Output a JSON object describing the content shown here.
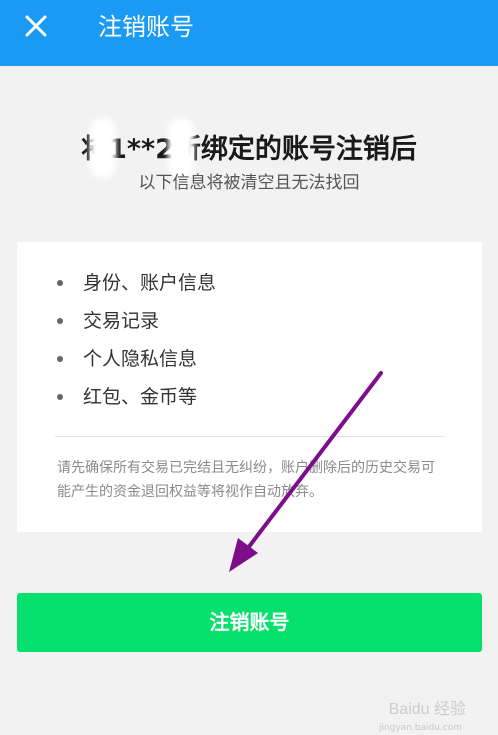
{
  "header": {
    "title": "注销账号",
    "close_icon": "close-icon"
  },
  "warning": {
    "heading": "将1**2所绑定的账号注销后",
    "subheading": "以下信息将被清空且无法找回"
  },
  "info_list": [
    "身份、账户信息",
    "交易记录",
    "个人隐私信息",
    "红包、金币等"
  ],
  "notice": "请先确保所有交易已完结且无纠纷，账户删除后的历史交易可能产生的资金退回权益等将视作自动放弃。",
  "action_button": {
    "label": "注销账号"
  },
  "watermark": {
    "text": "Baidu 经验",
    "url": "jingyan.baidu.com"
  },
  "colors": {
    "header_bg": "#1a9af2",
    "button_bg": "#06e16d",
    "arrow": "#7d0d8a",
    "page_bg": "#f2f2f2"
  }
}
